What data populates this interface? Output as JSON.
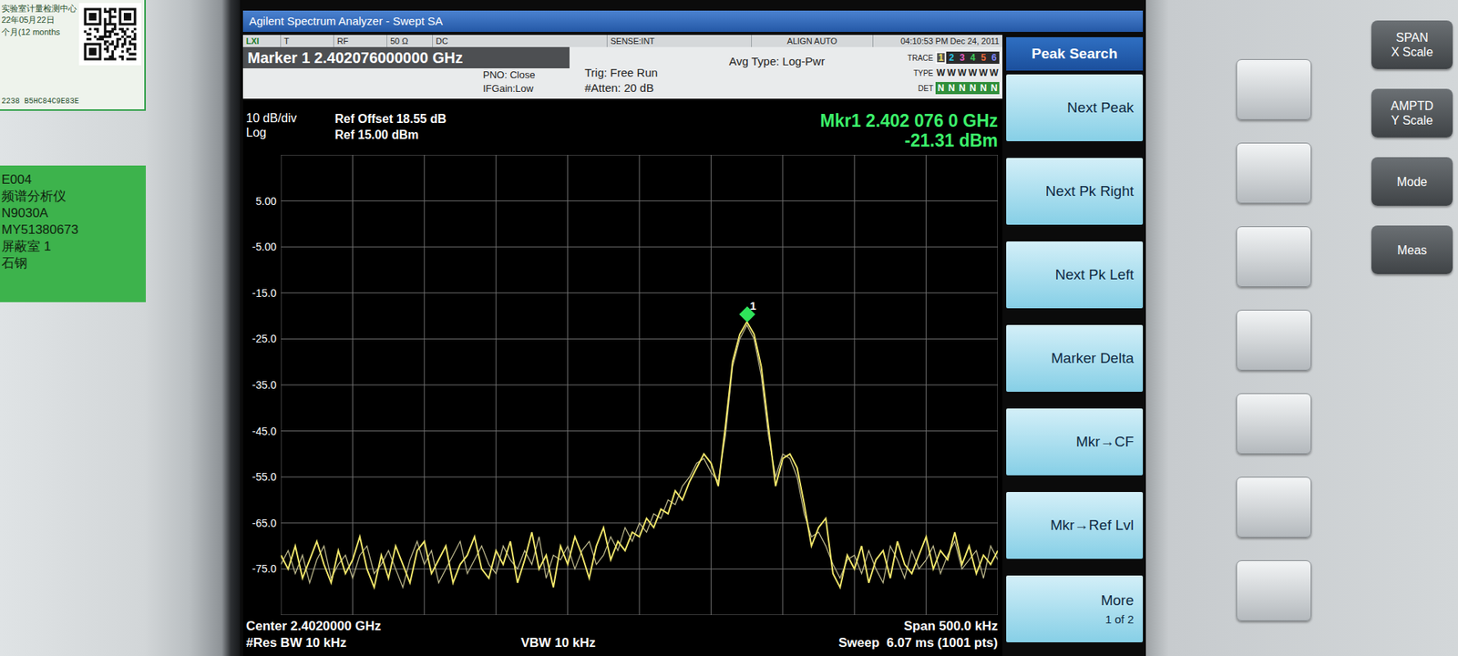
{
  "labels": {
    "calibration": [
      "实验室计量检测中心",
      "22年05月22日",
      "个月(12 months"
    ],
    "calibration_code": "2238 B5HC84C9E83E",
    "asset": [
      "E004",
      "频谱分析仪",
      "N9030A",
      "MY51380673",
      "屏蔽室 1",
      "石钢"
    ]
  },
  "window": {
    "title": "Agilent Spectrum Analyzer - Swept SA"
  },
  "status_bar": [
    "LXI",
    "T",
    "RF",
    "50 Ω",
    "DC",
    "SENSE:INT",
    "ALIGN AUTO",
    "04:10:53 PM Dec 24, 2011"
  ],
  "header": {
    "marker_title": "Marker 1 2.402076000000 GHz",
    "pno": "PNO: Close",
    "ifgain": "IFGain:Low",
    "trig": "Trig: Free Run",
    "atten": "#Atten: 20 dB",
    "avg": "Avg Type: Log-Pwr",
    "trace_label": "TRACE",
    "type_label": "TYPE",
    "det_label": "DET",
    "traces": [
      {
        "number": "1",
        "type": "W",
        "det": "N",
        "color": "#f5e663",
        "selected": true
      },
      {
        "number": "2",
        "type": "W",
        "det": "N",
        "color": "#27c6e8",
        "selected": false
      },
      {
        "number": "3",
        "type": "W",
        "det": "N",
        "color": "#e85fc8",
        "selected": false
      },
      {
        "number": "4",
        "type": "W",
        "det": "N",
        "color": "#3fcf5a",
        "selected": false
      },
      {
        "number": "5",
        "type": "W",
        "det": "N",
        "color": "#f06b3a",
        "selected": false
      },
      {
        "number": "6",
        "type": "W",
        "det": "N",
        "color": "#7f88ff",
        "selected": false
      }
    ]
  },
  "display": {
    "scale": "10 dB/div",
    "scale_type": "Log",
    "ref_offset": "Ref Offset 18.55 dB",
    "ref_level": "Ref 15.00 dBm",
    "marker_freq": "Mkr1 2.402 076 0 GHz",
    "marker_value": "-21.31 dBm"
  },
  "chart": {
    "y_max": 15,
    "y_min": -85,
    "y_ticks": [
      "5.00",
      "-5.00",
      "-15.0",
      "-25.0",
      "-35.0",
      "-45.0",
      "-55.0",
      "-65.0",
      "-75.0"
    ],
    "series": [
      {
        "name": "trace1",
        "color": "#f2e66a",
        "values": [
          -72,
          -75,
          -70,
          -77,
          -73,
          -69,
          -74,
          -78,
          -71,
          -76,
          -73,
          -68,
          -75,
          -79,
          -72,
          -77,
          -70,
          -74,
          -78,
          -71,
          -69,
          -76,
          -73,
          -70,
          -78,
          -74,
          -72,
          -68,
          -75,
          -77,
          -71,
          -74,
          -69,
          -78,
          -73,
          -67,
          -75,
          -72,
          -79,
          -70,
          -74,
          -68,
          -72,
          -77,
          -70,
          -66,
          -73,
          -69,
          -71,
          -67,
          -68,
          -64,
          -66,
          -62,
          -63,
          -58,
          -60,
          -56,
          -53,
          -50,
          -52,
          -57,
          -44,
          -30,
          -24,
          -21.31,
          -24,
          -31,
          -44,
          -57,
          -51,
          -50,
          -53,
          -61,
          -70,
          -66,
          -64,
          -76,
          -79,
          -72,
          -75,
          -70,
          -78,
          -73,
          -71,
          -77,
          -69,
          -74,
          -76,
          -72,
          -68,
          -75,
          -71,
          -73,
          -67,
          -74,
          -70,
          -76,
          -72,
          -74,
          -71
        ]
      },
      {
        "name": "trace2",
        "color": "#bdb88c",
        "values": [
          -74,
          -71,
          -76,
          -72,
          -78,
          -73,
          -70,
          -77,
          -74,
          -72,
          -77,
          -72,
          -70,
          -76,
          -74,
          -71,
          -75,
          -79,
          -73,
          -69,
          -74,
          -71,
          -78,
          -75,
          -72,
          -69,
          -76,
          -73,
          -70,
          -74,
          -76,
          -70,
          -73,
          -75,
          -71,
          -74,
          -68,
          -77,
          -72,
          -73,
          -70,
          -75,
          -71,
          -69,
          -74,
          -72,
          -68,
          -71,
          -66,
          -69,
          -65,
          -67,
          -63,
          -64,
          -60,
          -61,
          -57,
          -55,
          -52,
          -51,
          -54,
          -56,
          -46,
          -31,
          -25,
          -22,
          -25,
          -33,
          -46,
          -55,
          -50,
          -51,
          -55,
          -63,
          -68,
          -67,
          -70,
          -74,
          -77,
          -73,
          -72,
          -76,
          -71,
          -75,
          -78,
          -70,
          -73,
          -77,
          -71,
          -75,
          -73,
          -70,
          -76,
          -72,
          -69,
          -75,
          -73,
          -71,
          -77,
          -70,
          -73
        ]
      }
    ],
    "marker": {
      "label": "1",
      "series": 0
    }
  },
  "footer": {
    "center": "Center 2.4020000 GHz",
    "span": "Span 500.0 kHz",
    "rbw": "#Res BW 10 kHz",
    "vbw": "VBW 10 kHz",
    "sweep": "Sweep  6.07 ms (1001 pts)"
  },
  "softkeys": {
    "title": "Peak Search",
    "keys": [
      {
        "label": "Next Peak"
      },
      {
        "label": "Next Pk Right"
      },
      {
        "label": "Next Pk Left"
      },
      {
        "label": "Marker Delta"
      },
      {
        "label": "Mkr→CF"
      },
      {
        "label": "Mkr→Ref Lvl"
      },
      {
        "label": "More",
        "sub": "1 of 2"
      }
    ]
  },
  "hard_keys": [
    {
      "label": "SPAN",
      "sub": "X Scale"
    },
    {
      "label": "AMPTD",
      "sub": "Y Scale"
    },
    {
      "label": "Mode"
    },
    {
      "label": "Meas"
    }
  ]
}
